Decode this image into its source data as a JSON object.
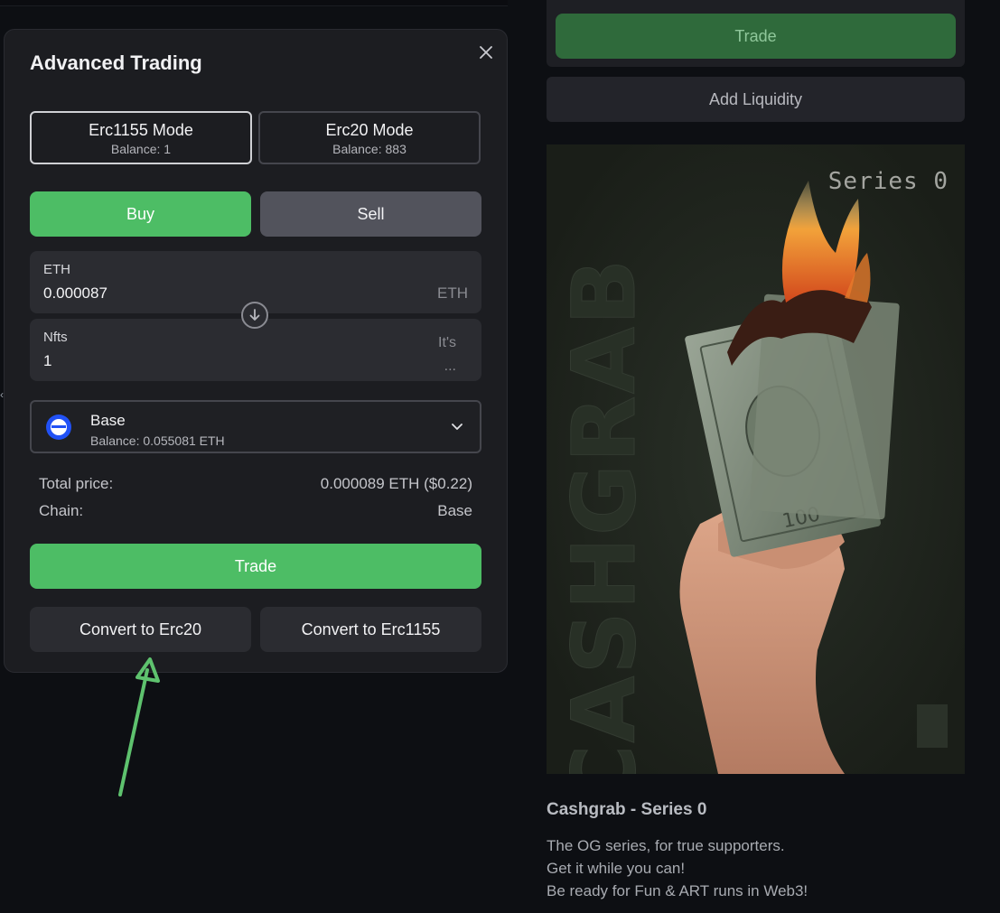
{
  "modal": {
    "title": "Advanced Trading",
    "close_icon": "close-icon",
    "modes": [
      {
        "label": "Erc1155 Mode",
        "balance": "Balance: 1",
        "active": true
      },
      {
        "label": "Erc20 Mode",
        "balance": "Balance: 883",
        "active": false
      }
    ],
    "buy_label": "Buy",
    "sell_label": "Sell",
    "pay_field": {
      "label": "ETH",
      "value": "0.000087",
      "unit": "ETH"
    },
    "swap_icon": "arrow-down-circle-icon",
    "receive_field": {
      "label": "Nfts",
      "value": "1",
      "hint_line1": "It's",
      "hint_line2": "..."
    },
    "chain_select": {
      "name": "Base",
      "balance": "Balance: 0.055081 ETH",
      "icon": "base-chain-logo",
      "chevron": "chevron-down-icon"
    },
    "summary": [
      {
        "label": "Total price:",
        "value": "0.000089 ETH ($0.22)"
      },
      {
        "label": "Chain:",
        "value": "Base"
      }
    ],
    "trade_label": "Trade",
    "convert_erc20_label": "Convert to Erc20",
    "convert_erc1155_label": "Convert to Erc1155"
  },
  "right_panel": {
    "trade_label": "Trade",
    "add_liquidity_label": "Add Liquidity",
    "artwork": {
      "series_text": "Series 0",
      "vertical_text": "CASHGRAB"
    },
    "title": "Cashgrab - Series 0",
    "description": [
      "The OG series, for true supporters.",
      "Get it while you can!",
      "Be ready for Fun & ART runs in Web3!"
    ]
  },
  "colors": {
    "accent_green": "#4dbd65",
    "annotation_green": "#5ec26e",
    "base_blue": "#2151f5"
  }
}
